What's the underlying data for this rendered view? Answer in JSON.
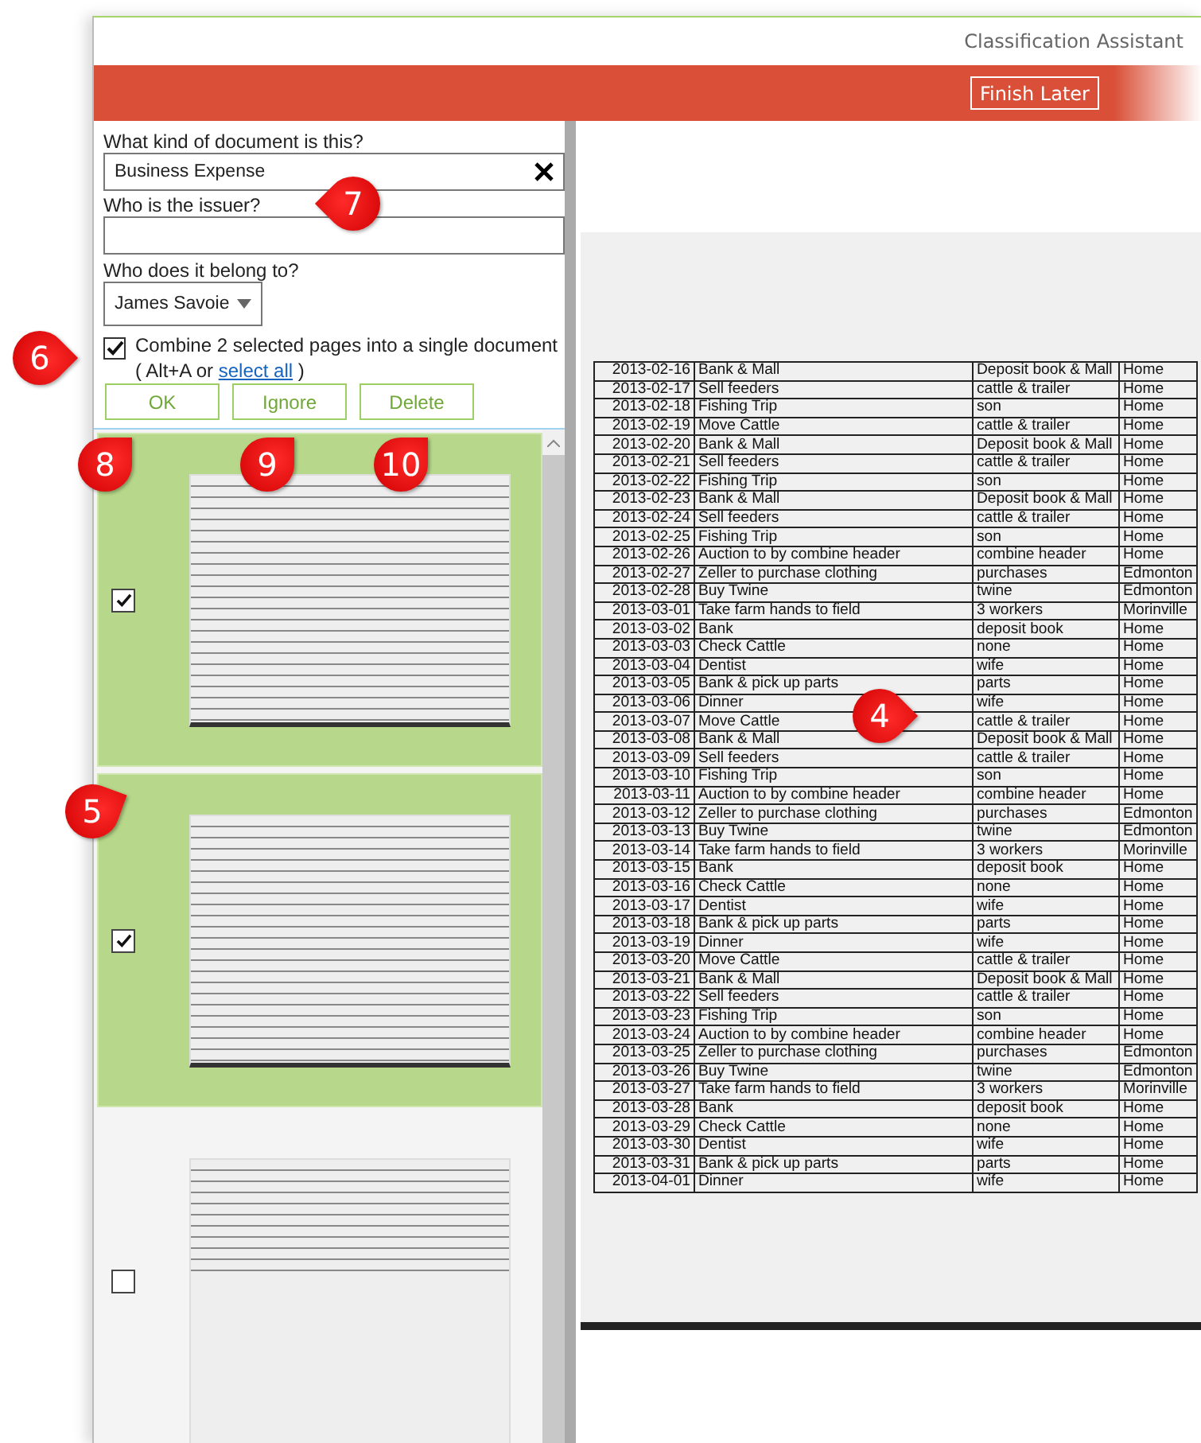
{
  "window": {
    "title": "Classification Assistant"
  },
  "toolbar": {
    "finish_button": "Finish Later"
  },
  "form": {
    "document_type": {
      "label": "What kind of document is this?",
      "value": "Business Expense"
    },
    "issuer": {
      "label": "Who is the issuer?"
    },
    "owner": {
      "label": "Who does it belong to?",
      "value": "James Savoie"
    },
    "combine": {
      "checked": true,
      "label": "Combine 2 selected pages into a single document",
      "hint_before": "( Alt+A or",
      "link": "select all",
      "hint_after": ")"
    },
    "buttons": [
      "OK",
      "Ignore",
      "Delete"
    ]
  },
  "pages": [
    {
      "selected": true,
      "checked": true
    },
    {
      "selected": true,
      "checked": true
    },
    {
      "selected": false,
      "checked": false
    }
  ],
  "document": {
    "rows": [
      [
        "2013-02-16",
        "Bank & Mall",
        "Deposit book & Mall",
        "Home"
      ],
      [
        "2013-02-17",
        "Sell feeders",
        "cattle & trailer",
        "Home"
      ],
      [
        "2013-02-18",
        "Fishing Trip",
        "son",
        "Home"
      ],
      [
        "2013-02-19",
        "Move Cattle",
        "cattle & trailer",
        "Home"
      ],
      [
        "2013-02-20",
        "Bank & Mall",
        "Deposit book & Mall",
        "Home"
      ],
      [
        "2013-02-21",
        "Sell feeders",
        "cattle & trailer",
        "Home"
      ],
      [
        "2013-02-22",
        "Fishing Trip",
        "son",
        "Home"
      ],
      [
        "2013-02-23",
        "Bank & Mall",
        "Deposit book & Mall",
        "Home"
      ],
      [
        "2013-02-24",
        "Sell feeders",
        "cattle & trailer",
        "Home"
      ],
      [
        "2013-02-25",
        "Fishing Trip",
        "son",
        "Home"
      ],
      [
        "2013-02-26",
        "Auction to by combine header",
        "combine header",
        "Home"
      ],
      [
        "2013-02-27",
        "Zeller to purchase clothing",
        "purchases",
        "Edmonton"
      ],
      [
        "2013-02-28",
        "Buy Twine",
        "twine",
        "Edmonton"
      ],
      [
        "2013-03-01",
        "Take farm hands to field",
        "3 workers",
        "Morinville"
      ],
      [
        "2013-03-02",
        "Bank",
        "deposit book",
        "Home"
      ],
      [
        "2013-03-03",
        "Check Cattle",
        "none",
        "Home"
      ],
      [
        "2013-03-04",
        "Dentist",
        "wife",
        "Home"
      ],
      [
        "2013-03-05",
        "Bank & pick up parts",
        "parts",
        "Home"
      ],
      [
        "2013-03-06",
        "Dinner",
        "wife",
        "Home"
      ],
      [
        "2013-03-07",
        "Move Cattle",
        "cattle & trailer",
        "Home"
      ],
      [
        "2013-03-08",
        "Bank & Mall",
        "Deposit book & Mall",
        "Home"
      ],
      [
        "2013-03-09",
        "Sell feeders",
        "cattle & trailer",
        "Home"
      ],
      [
        "2013-03-10",
        "Fishing Trip",
        "son",
        "Home"
      ],
      [
        "2013-03-11",
        "Auction to by combine header",
        "combine header",
        "Home"
      ],
      [
        "2013-03-12",
        "Zeller to purchase clothing",
        "purchases",
        "Edmonton"
      ],
      [
        "2013-03-13",
        "Buy Twine",
        "twine",
        "Edmonton"
      ],
      [
        "2013-03-14",
        "Take farm hands to field",
        "3 workers",
        "Morinville"
      ],
      [
        "2013-03-15",
        "Bank",
        "deposit book",
        "Home"
      ],
      [
        "2013-03-16",
        "Check Cattle",
        "none",
        "Home"
      ],
      [
        "2013-03-17",
        "Dentist",
        "wife",
        "Home"
      ],
      [
        "2013-03-18",
        "Bank & pick up parts",
        "parts",
        "Home"
      ],
      [
        "2013-03-19",
        "Dinner",
        "wife",
        "Home"
      ],
      [
        "2013-03-20",
        "Move Cattle",
        "cattle & trailer",
        "Home"
      ],
      [
        "2013-03-21",
        "Bank & Mall",
        "Deposit book & Mall",
        "Home"
      ],
      [
        "2013-03-22",
        "Sell feeders",
        "cattle & trailer",
        "Home"
      ],
      [
        "2013-03-23",
        "Fishing Trip",
        "son",
        "Home"
      ],
      [
        "2013-03-24",
        "Auction to by combine header",
        "combine header",
        "Home"
      ],
      [
        "2013-03-25",
        "Zeller to purchase clothing",
        "purchases",
        "Edmonton"
      ],
      [
        "2013-03-26",
        "Buy Twine",
        "twine",
        "Edmonton"
      ],
      [
        "2013-03-27",
        "Take farm hands to field",
        "3 workers",
        "Morinville"
      ],
      [
        "2013-03-28",
        "Bank",
        "deposit book",
        "Home"
      ],
      [
        "2013-03-29",
        "Check Cattle",
        "none",
        "Home"
      ],
      [
        "2013-03-30",
        "Dentist",
        "wife",
        "Home"
      ],
      [
        "2013-03-31",
        "Bank & pick up parts",
        "parts",
        "Home"
      ],
      [
        "2013-04-01",
        "Dinner",
        "wife",
        "Home"
      ]
    ]
  },
  "callouts": [
    {
      "label": "4"
    },
    {
      "label": "5"
    },
    {
      "label": "6"
    },
    {
      "label": "7"
    },
    {
      "label": "8"
    },
    {
      "label": "9"
    },
    {
      "label": "10"
    }
  ]
}
